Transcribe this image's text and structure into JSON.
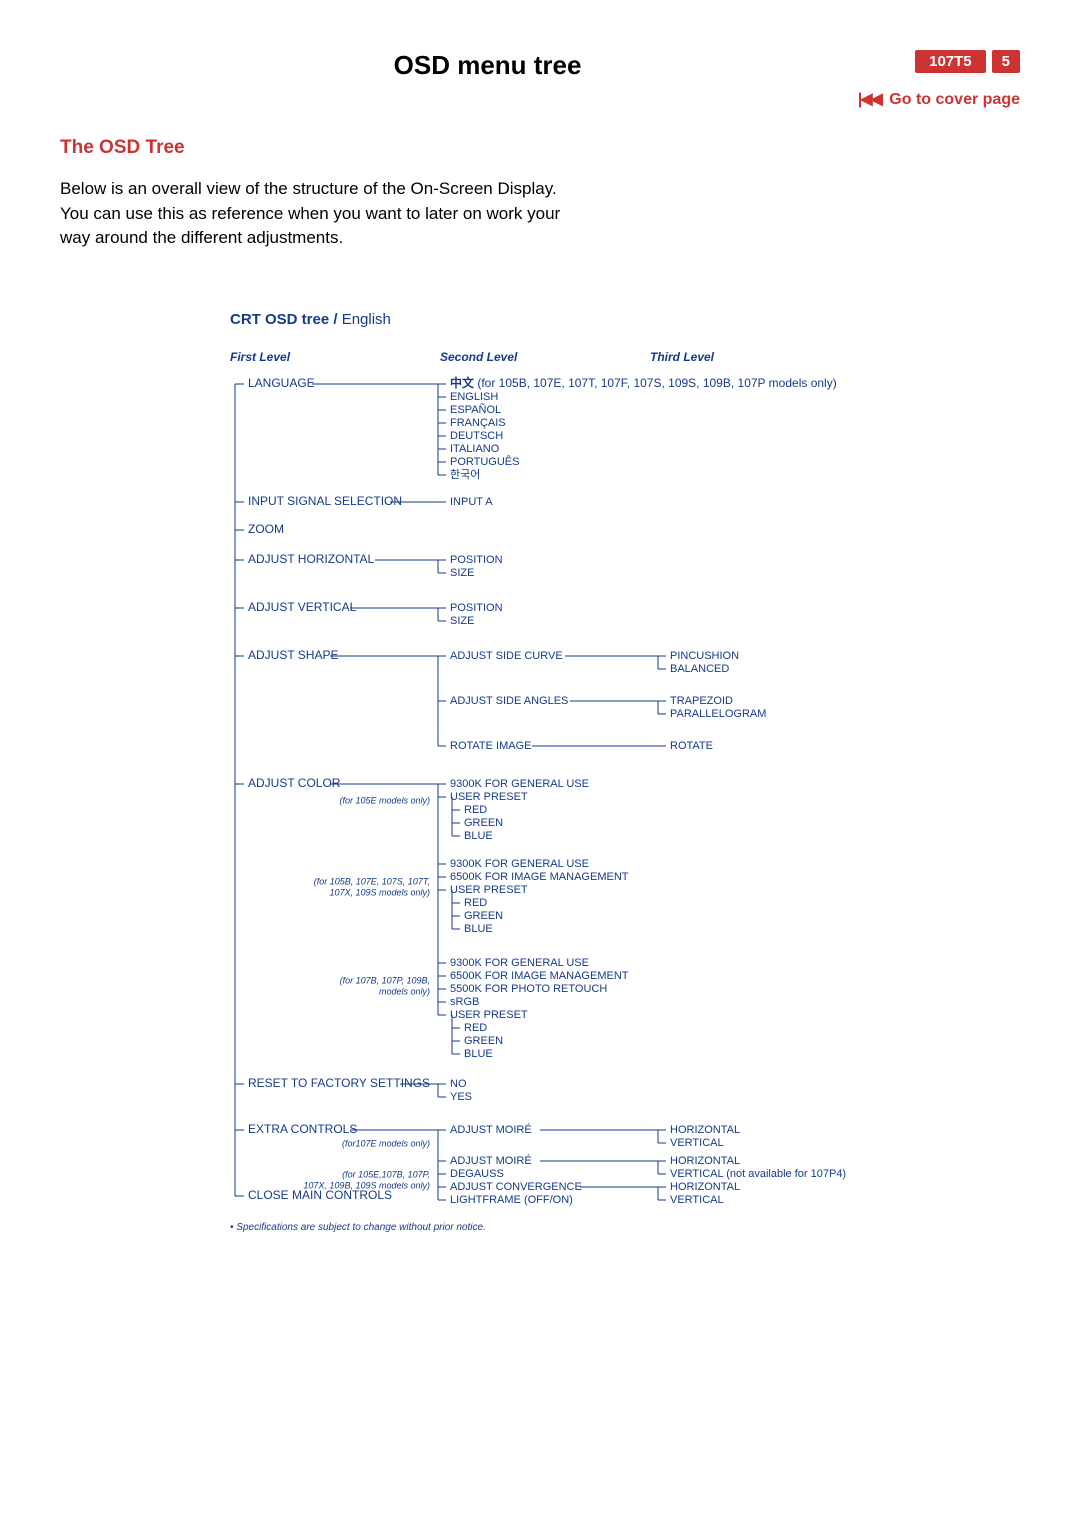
{
  "header": {
    "title": "OSD menu tree",
    "model": "107T5",
    "page_num": "5",
    "cover_link": "Go to cover page"
  },
  "section": {
    "title": "The OSD Tree",
    "intro": "Below is an overall view of the structure of the On-Screen Display. You can use this as reference when you want to later on work your way around the different adjustments."
  },
  "tree": {
    "title_bold": "CRT OSD tree /",
    "title_reg": " English",
    "levels": {
      "l1": "First Level",
      "l2": "Second Level",
      "l3": "Third Level"
    },
    "l1": {
      "language": "LANGUAGE",
      "input_signal": "INPUT SIGNAL SELECTION",
      "zoom": "ZOOM",
      "adj_h": "ADJUST HORIZONTAL",
      "adj_v": "ADJUST VERTICAL",
      "adj_shape": "ADJUST SHAPE",
      "adj_color": "ADJUST COLOR",
      "reset": "RESET TO FACTORY SETTINGS",
      "extra": "EXTRA CONTROLS",
      "close": "CLOSE MAIN CONTROLS"
    },
    "lang": {
      "cn": "中文",
      "cn_note": " (for 105B, 107E, 107T, 107F, 107S, 109S, 109B, 107P models only)",
      "en": "ENGLISH",
      "es": "ESPAÑOL",
      "fr": "FRANÇAIS",
      "de": "DEUTSCH",
      "it": "ITALIANO",
      "pt": "PORTUGUÊS",
      "kr": "한국어"
    },
    "input_a": "INPUT A",
    "pos_size": {
      "position": "POSITION",
      "size": "SIZE"
    },
    "shape": {
      "side_curve": "ADJUST SIDE CURVE",
      "side_angles": "ADJUST SIDE ANGLES",
      "rotate_image": "ROTATE IMAGE",
      "pincushion": "PINCUSHION",
      "balanced": "BALANCED",
      "trapezoid": "TRAPEZOID",
      "parallelogram": "PARALLELOGRAM",
      "rotate": "ROTATE"
    },
    "color_notes": {
      "n1": "(for 105E models only)",
      "n2a": "(for 105B, 107E, 107S, 107T,",
      "n2b": "107X, 109S models only)",
      "n3a": "(for 107B, 107P, 109B,",
      "n3b": "models only)"
    },
    "color": {
      "k9300": "9300K FOR GENERAL USE",
      "k6500": "6500K FOR IMAGE MANAGEMENT",
      "k5500": "5500K FOR PHOTO RETOUCH",
      "srgb": "sRGB",
      "user_preset": "USER PRESET",
      "red": "RED",
      "green": "GREEN",
      "blue": "BLUE"
    },
    "reset_opts": {
      "no": "NO",
      "yes": "YES"
    },
    "extra_notes": {
      "n1": "(for107E models only)",
      "n2a": "(for 105E,107B, 107P,",
      "n2b": "107X, 109B, 109S models only)"
    },
    "extra": {
      "adj_moire": "ADJUST MOIRÉ",
      "degauss": "DEGAUSS",
      "adj_conv": "ADJUST CONVERGENCE",
      "lightframe": "LIGHTFRAME (OFF/ON)",
      "horizontal": "HORIZONTAL",
      "vertical": "VERTICAL",
      "vert_note": " (not available for 107P4)"
    },
    "footnote": "• Specifications are subject to change without prior notice."
  }
}
